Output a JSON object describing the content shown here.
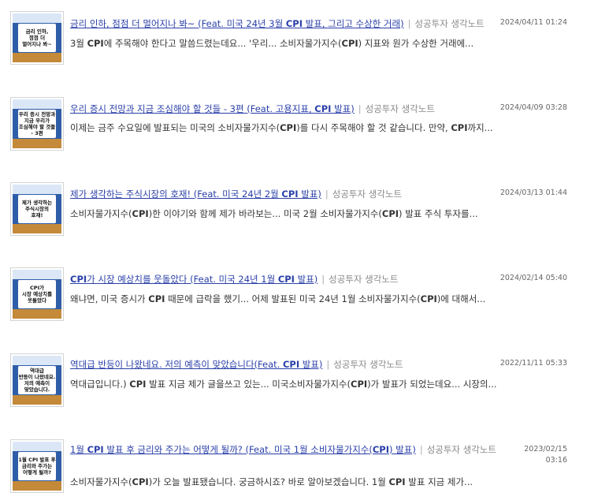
{
  "posts": [
    {
      "thumb_text": "금리 인하,\n점점 더\n멀어지나 봐~",
      "title": "금리 인하, 점점 더 멀어지나 봐~ (Feat. 미국 24년 3월 CPI 발표, 그리고 수상한 거래)",
      "source": "성공투자 생각노트",
      "date": "2024/04/11 01:24",
      "snippet": "3월 CPI에 주목해야 한다고 말씀드렸는데요... '우리... 소비자물가지수(CPI) 지표와 원가 수상한 거래에..."
    },
    {
      "thumb_text": "우리 증시 전망과\n지금 우리가\n조심해야 할 것들\n- 3편",
      "title": "우리 증시 전망과 지금 조심해야 할 것들 - 3편 (Feat. 고용지표, CPI 발표)",
      "source": "성공투자 생각노트",
      "date": "2024/04/09 03:28",
      "snippet": "이제는 금주 수요일에 발표되는 미국의 소비자물가지수(CPI)를 다시 주목해야 할 것 같습니다. 만약, CPI까지..."
    },
    {
      "thumb_text": "제가 생각하는\n주식시장의\n호재!",
      "title": "제가 생각하는 주식시장의 호재! (Feat. 미국 24년 2월 CPI 발표)",
      "source": "성공투자 생각노트",
      "date": "2024/03/13 01:44",
      "snippet": "소비자물가지수(CPI)한 이야기와 함께 제가 바라보는... 미국 2월 소비자물가지수(CPI) 발표 주식 투자를..."
    },
    {
      "thumb_text": "CPI가\n시장 예상치를\n웃돌았다",
      "title": "CPI가 시장 예상치를 웃돌았다 (Feat. 미국 24년 1월 CPI 발표)",
      "source": "성공투자 생각노트",
      "date": "2024/02/14 05:40",
      "snippet": "왜냐면, 미국 증시가 CPI 때문에 급락을 했기... 어제 발표된 미국 24년 1월 소비자물가지수(CPI)에 대해서..."
    },
    {
      "thumb_text": "역대급\n반등이 나왔네요.\n저의 예측이\n맞았습니다.",
      "title": "역대급 반등이 나왔네요. 저의 예측이 맞았습니다(Feat. CPI 발표)",
      "source": "성공투자 생각노트",
      "date": "2022/11/11 05:33",
      "snippet": "역대급입니다.) CPI 발표 지금 제가 글을쓰고 있는... 미국소비자물가지수(CPI)가 발표가 되었는데요... 시장의..."
    },
    {
      "thumb_text": "1월 CPI 발표 후\n금리와 주가는\n어떻게 될까?",
      "title": "1월 CPI 발표 후 금리와 주가는 어떻게 될까? (Feat. 미국 1월 소비자물가지수(CPI) 발표)",
      "source": "성공투자 생각노트",
      "date": "2023/02/15 03:16",
      "snippet": "소비자물가지수(CPI)가 오늘 발표됐습니다. 궁금하시죠? 바로 알아보겠습니다. 1월 CPI 발표 지금 제가..."
    }
  ]
}
